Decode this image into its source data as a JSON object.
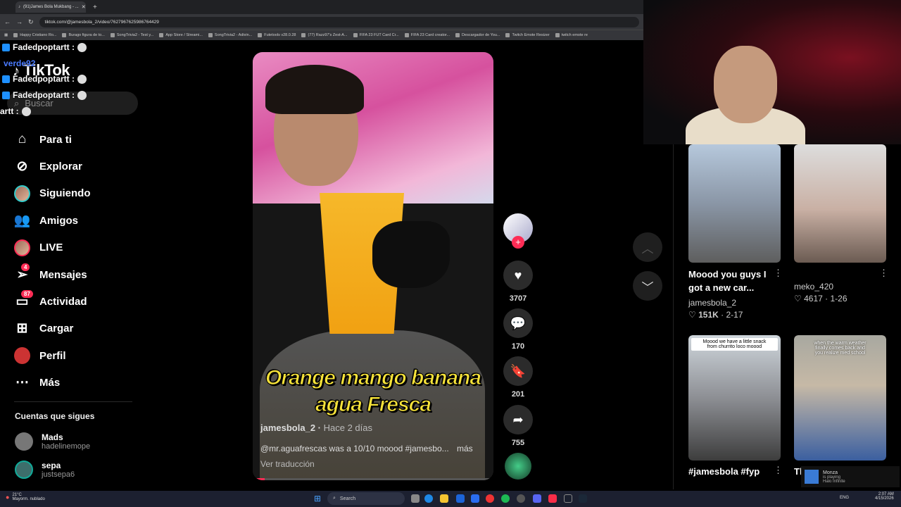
{
  "browser": {
    "tab_title": "(91)James Bola Mukbang - ...",
    "url": "tiktok.com/@jamesbola_2/video/7627967625986764429",
    "bookmarks": [
      "Happy Cristiano Ro...",
      "Burago figura de to...",
      "SongTrivia2 - Test y...",
      "App Store / Streami...",
      "SongTrivia2 - Adivin...",
      "Futetools v28.0.28",
      "(77) Razz97's Zest-A...",
      "FIFA 23 FUT Card Cr...",
      "FIFA 23 Card creator...",
      "Descargador de You...",
      "Twitch Emote Resizer",
      "twitch emote re"
    ]
  },
  "chat": [
    {
      "user": "Fadedpoptartt :"
    },
    {
      "user": "verde92"
    },
    {
      "user": "Fadedpoptartt :"
    },
    {
      "user": "Fadedpoptartt :"
    },
    {
      "user": "artt :"
    }
  ],
  "sidebar": {
    "logo": "TikTok",
    "search_placeholder": "Buscar",
    "nav": [
      {
        "label": "Para ti",
        "icon": "home-icon"
      },
      {
        "label": "Explorar",
        "icon": "compass-icon"
      },
      {
        "label": "Siguiendo",
        "icon": "following-avatar"
      },
      {
        "label": "Amigos",
        "icon": "friends-icon"
      },
      {
        "label": "LIVE",
        "icon": "live-avatar"
      },
      {
        "label": "Mensajes",
        "icon": "messages-icon",
        "badge": "4"
      },
      {
        "label": "Actividad",
        "icon": "activity-icon",
        "badge": "87"
      },
      {
        "label": "Cargar",
        "icon": "upload-icon"
      },
      {
        "label": "Perfil",
        "icon": "profile-avatar"
      },
      {
        "label": "Más",
        "icon": "more-icon"
      }
    ],
    "following_title": "Cuentas que sigues",
    "following": [
      {
        "name": "Mads",
        "handle": "hadelinemope"
      },
      {
        "name": "sepa",
        "handle": "justsepa6"
      }
    ]
  },
  "video": {
    "caption_line1": "Orange mango banana",
    "caption_line2": "agua Fresca",
    "author": "jamesbola_2",
    "age": "Hace 2 días",
    "description": "@mr.aguafrescas was a 10/10 moood #jamesbo...",
    "more": "más",
    "translate": "Ver traducción"
  },
  "actions": {
    "likes": "3707",
    "comments": "170",
    "saves": "201",
    "shares": "755"
  },
  "grid": [
    {
      "title_l1": "Moood you guys I",
      "title_l2": "got a new car...",
      "user": "jamesbola_2",
      "likes": "151K",
      "date": "2-17"
    },
    {
      "title_l1": "",
      "title_l2": "",
      "user": "meko_420",
      "likes": "4617",
      "date": "1-26"
    },
    {
      "label_l1": "Moood we have a little snack",
      "label_l2": "from churrito loco moood",
      "title_l1": "#jamesbola #fyp",
      "user": "",
      "likes": "",
      "date": ""
    },
    {
      "label_l1": "when the warm weather",
      "label_l2": "finally comes back and",
      "label_l3": "you realize med school",
      "title_l1": "Tl",
      "user": "",
      "likes": "",
      "date": ""
    }
  ],
  "now_playing": {
    "name": "Monza",
    "status": "is playing",
    "game": "Halo Infinite"
  },
  "taskbar": {
    "weather_temp": "21°C",
    "weather_desc": "Mayorm. nublado",
    "search": "Search",
    "lang": "ENG",
    "time": "2:07 AM",
    "date": "4/15/2026"
  },
  "colors": {
    "accent": "#fe2c55",
    "caption": "#f7e33a"
  }
}
